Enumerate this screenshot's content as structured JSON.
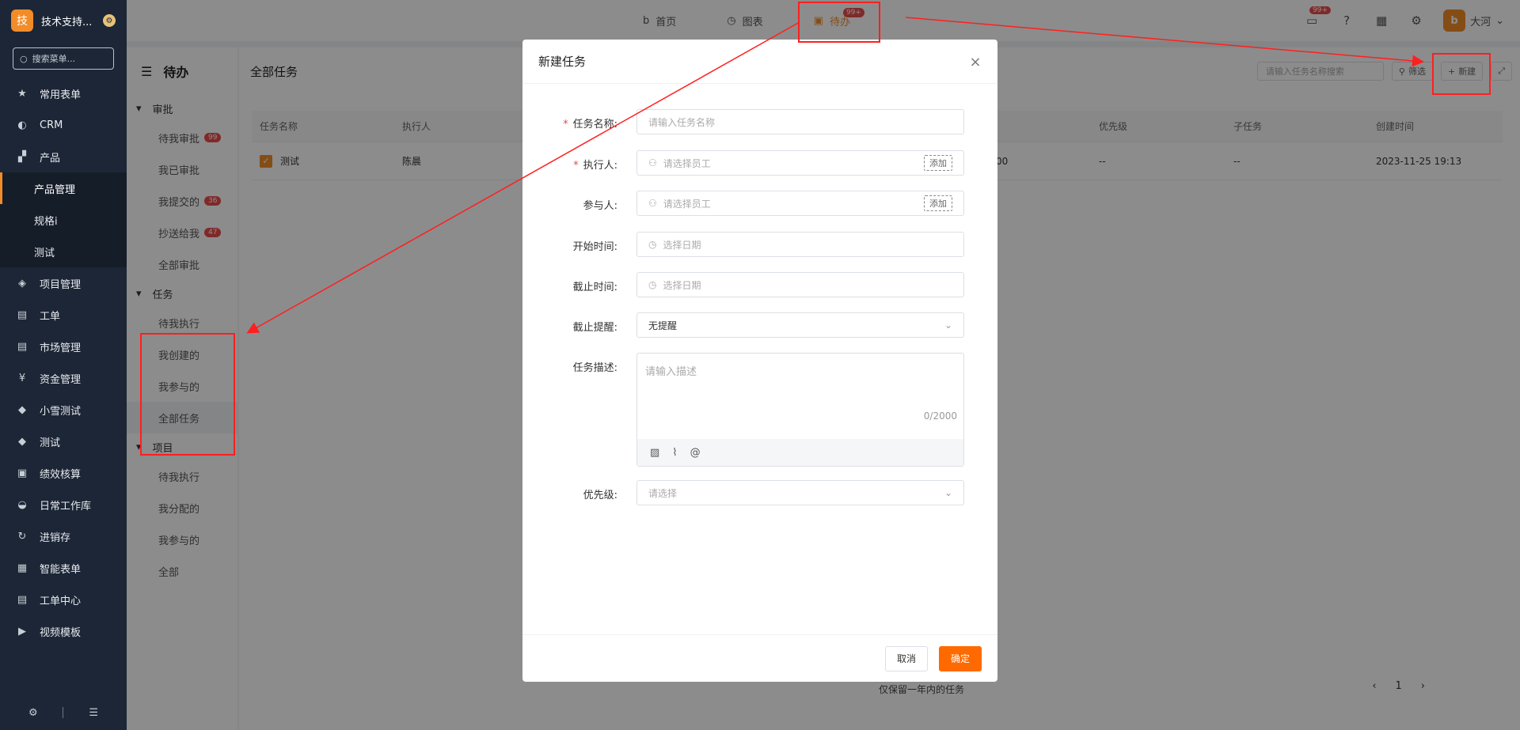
{
  "sidebar": {
    "brand_letter": "技",
    "brand_name": "技术支持...",
    "brand_badge": "⚙",
    "search_placeholder": "搜索菜单...",
    "items": [
      {
        "label": "常用表单",
        "icon": "star-icon"
      },
      {
        "label": "CRM",
        "icon": "pie-icon"
      },
      {
        "label": "产品",
        "icon": "grid-icon"
      }
    ],
    "sub_items": [
      {
        "label": "产品管理"
      },
      {
        "label": "规格i"
      },
      {
        "label": "测试"
      }
    ],
    "items_after": [
      {
        "label": "项目管理",
        "icon": "layers-icon"
      },
      {
        "label": "工单",
        "icon": "clipboard-icon"
      },
      {
        "label": "市场管理",
        "icon": "clipboard-icon"
      },
      {
        "label": "资金管理",
        "icon": "money-icon"
      },
      {
        "label": "小雪测试",
        "icon": "tag-icon"
      },
      {
        "label": "测试",
        "icon": "tag-icon"
      },
      {
        "label": "绩效核算",
        "icon": "book-icon"
      },
      {
        "label": "日常工作库",
        "icon": "chart-icon"
      },
      {
        "label": "进销存",
        "icon": "sync-icon"
      },
      {
        "label": "智能表单",
        "icon": "form-icon"
      },
      {
        "label": "工单中心",
        "icon": "clipboard-icon"
      },
      {
        "label": "视频模板",
        "icon": "video-icon"
      }
    ]
  },
  "topnav": {
    "tabs": [
      {
        "label": "首页",
        "icon": "b-icon"
      },
      {
        "label": "图表",
        "icon": "clock-icon"
      },
      {
        "label": "待办",
        "icon": "calendar-icon",
        "badge": "99+"
      }
    ],
    "message_badge": "99+",
    "user_name": "大河",
    "user_avatar": "b"
  },
  "subpanel": {
    "title": "待办",
    "groups": [
      {
        "title": "审批",
        "items": [
          {
            "label": "待我审批",
            "count": "99"
          },
          {
            "label": "我已审批",
            "count": ""
          },
          {
            "label": "我提交的",
            "count": "36"
          },
          {
            "label": "抄送给我",
            "count": "47"
          },
          {
            "label": "全部审批",
            "count": ""
          }
        ]
      },
      {
        "title": "任务",
        "items": [
          {
            "label": "待我执行",
            "count": ""
          },
          {
            "label": "我创建的",
            "count": ""
          },
          {
            "label": "我参与的",
            "count": ""
          },
          {
            "label": "全部任务",
            "count": ""
          }
        ]
      },
      {
        "title": "项目",
        "items": [
          {
            "label": "待我执行",
            "count": ""
          },
          {
            "label": "我分配的",
            "count": ""
          },
          {
            "label": "我参与的",
            "count": ""
          },
          {
            "label": "全部",
            "count": ""
          }
        ]
      }
    ]
  },
  "main": {
    "title": "全部任务",
    "search_placeholder": "请输入任务名称搜索",
    "filter_label": "筛选",
    "new_label": "新建",
    "columns": [
      "任务名称",
      "执行人",
      "优先级",
      "子任务",
      "创建时间"
    ],
    "row": {
      "name": "测试",
      "assignee": "陈晨",
      "partial": "00",
      "priority": "--",
      "subtask": "--",
      "created": "2023-11-25 19:13"
    },
    "footnote": "仅保留一年内的任务",
    "page": "1"
  },
  "modal": {
    "title": "新建任务",
    "fields": {
      "task_name": {
        "label": "任务名称:",
        "placeholder": "请输入任务名称"
      },
      "executor": {
        "label": "执行人:",
        "placeholder": "请选择员工",
        "add": "添加"
      },
      "participants": {
        "label": "参与人:",
        "placeholder": "请选择员工",
        "add": "添加"
      },
      "start_time": {
        "label": "开始时间:",
        "placeholder": "选择日期"
      },
      "deadline": {
        "label": "截止时间:",
        "placeholder": "选择日期"
      },
      "reminder": {
        "label": "截止提醒:",
        "value": "无提醒"
      },
      "description": {
        "label": "任务描述:",
        "placeholder": "请输入描述",
        "count": "0/2000"
      },
      "priority": {
        "label": "优先级:",
        "placeholder": "请选择"
      }
    },
    "cancel_label": "取消",
    "ok_label": "确定"
  },
  "colors": {
    "accent": "#f28c28",
    "annotation": "#ff1f1f",
    "sidebar_bg": "#1c2636"
  }
}
